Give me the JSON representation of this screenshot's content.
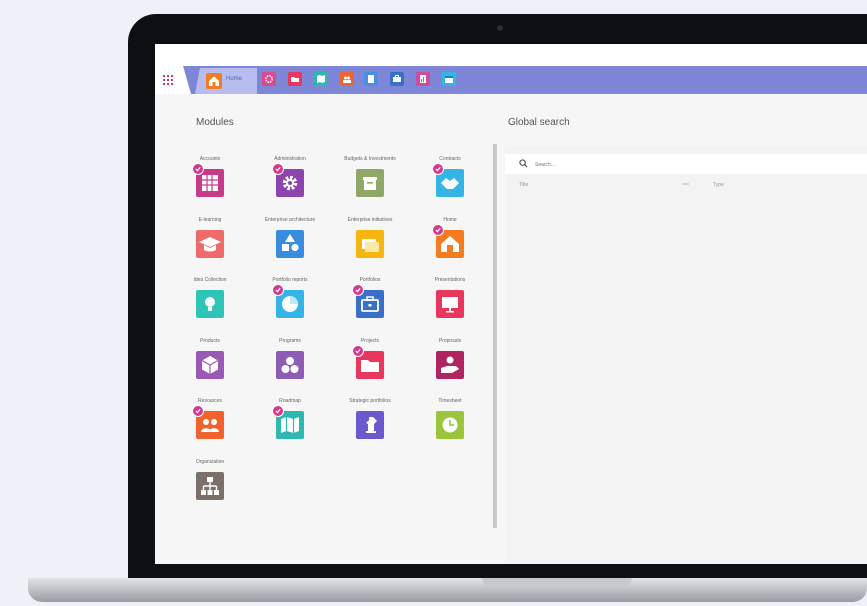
{
  "home_tab": {
    "label": "Home"
  },
  "tab_icons": [
    {
      "name": "gear",
      "color": "#d94b8d"
    },
    {
      "name": "folder",
      "color": "#e8365d"
    },
    {
      "name": "map",
      "color": "#2fb8b2"
    },
    {
      "name": "people",
      "color": "#f0632d"
    },
    {
      "name": "book",
      "color": "#4a90e2"
    },
    {
      "name": "briefcase",
      "color": "#3a6fc8"
    },
    {
      "name": "chart",
      "color": "#d24aa0"
    },
    {
      "name": "calendar",
      "color": "#35b5e5"
    }
  ],
  "modules_heading": "Modules",
  "search_heading": "Global search",
  "search": {
    "placeholder": "Search..."
  },
  "results_columns": [
    "Title",
    "Type"
  ],
  "modules": [
    {
      "label": "Accounts",
      "icon": "table",
      "color": "#c73a8a",
      "checked": true
    },
    {
      "label": "Administration",
      "icon": "gear",
      "color": "#8e44ad",
      "checked": true
    },
    {
      "label": "Budgets & Investments",
      "icon": "box",
      "color": "#8fa867",
      "checked": false
    },
    {
      "label": "Contracts",
      "icon": "handshake",
      "color": "#35b5e5",
      "checked": true
    },
    {
      "label": "E-learning",
      "icon": "graduation",
      "color": "#ef6b6b",
      "checked": false
    },
    {
      "label": "Enterprise architecture",
      "icon": "shapes",
      "color": "#3a8dde",
      "checked": false
    },
    {
      "label": "Enterprise initiatives",
      "icon": "folders",
      "color": "#f6b60f",
      "checked": false
    },
    {
      "label": "Home",
      "icon": "house",
      "color": "#f47c20",
      "checked": true
    },
    {
      "label": "Idea Collection",
      "icon": "bulb",
      "color": "#2ec4b6",
      "checked": false
    },
    {
      "label": "Portfolio reports",
      "icon": "pie",
      "color": "#35b5e5",
      "checked": true
    },
    {
      "label": "Portfolios",
      "icon": "briefcase",
      "color": "#3a6fc8",
      "checked": true
    },
    {
      "label": "Presentations",
      "icon": "screen",
      "color": "#e8365d",
      "checked": false
    },
    {
      "label": "Products",
      "icon": "cube",
      "color": "#9b59b6",
      "checked": false
    },
    {
      "label": "Programs",
      "icon": "circles",
      "color": "#8e5bb5",
      "checked": false
    },
    {
      "label": "Projects",
      "icon": "folder",
      "color": "#e8365d",
      "checked": true
    },
    {
      "label": "Proposals",
      "icon": "hand",
      "color": "#b0245f",
      "checked": false
    },
    {
      "label": "Resources",
      "icon": "people",
      "color": "#f0632d",
      "checked": true
    },
    {
      "label": "Roadmap",
      "icon": "map",
      "color": "#2fb8b2",
      "checked": true
    },
    {
      "label": "Strategic portfolios",
      "icon": "chess",
      "color": "#6a5acd",
      "checked": false
    },
    {
      "label": "Timesheet",
      "icon": "clock",
      "color": "#9bc53d",
      "checked": false
    },
    {
      "label": "Organization",
      "icon": "orgchart",
      "color": "#7b6f6a",
      "checked": false
    }
  ]
}
